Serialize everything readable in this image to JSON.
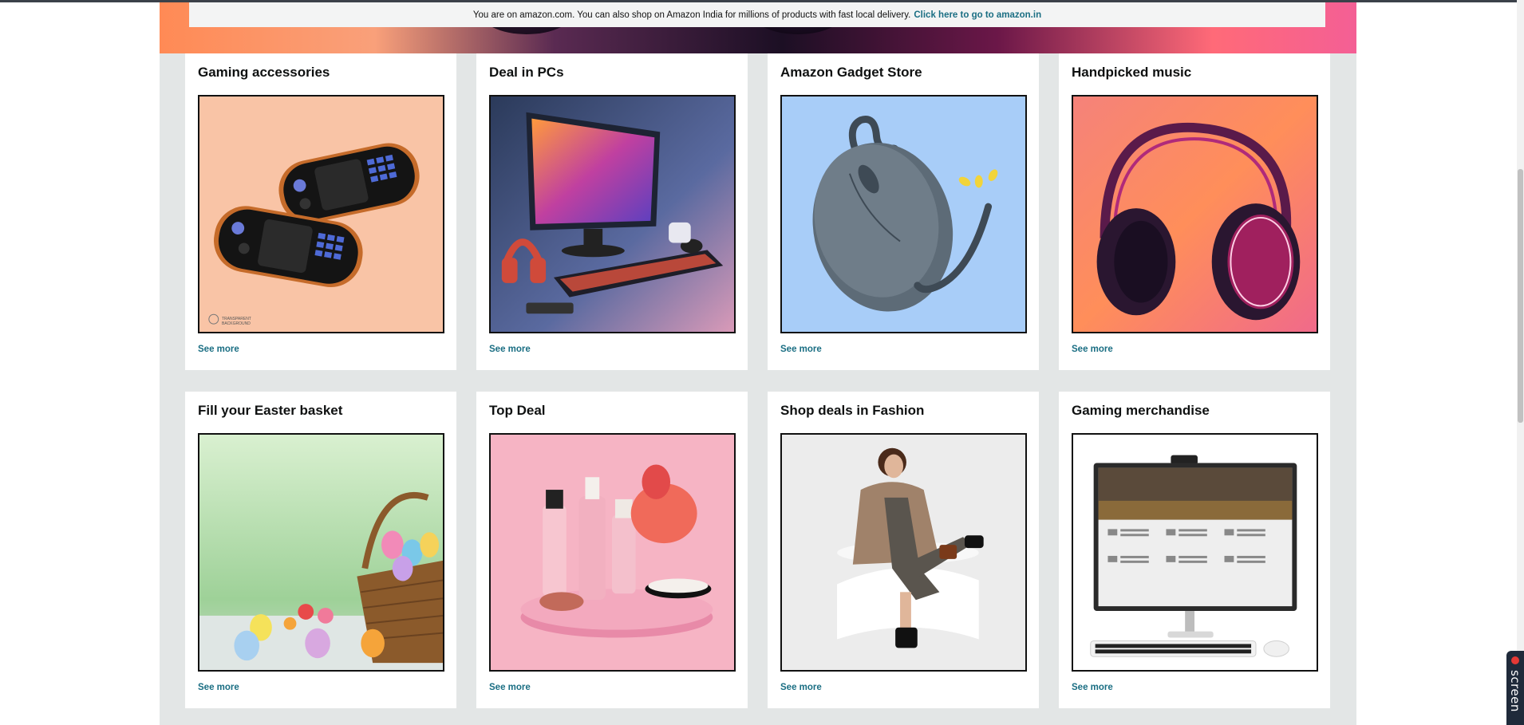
{
  "notice": {
    "text": "You are on amazon.com. You can also shop on Amazon India for millions of products with fast local delivery.",
    "link": "Click here to go to amazon.in"
  },
  "cards": [
    {
      "title": "Gaming accessories",
      "see_more": "See more",
      "image": "handheld-game-consoles",
      "image_caption": "TRANSPARENT BACKGROUND"
    },
    {
      "title": "Deal in PCs",
      "see_more": "See more",
      "image": "desktop-pc-setup"
    },
    {
      "title": "Amazon Gadget Store",
      "see_more": "See more",
      "image": "computer-mouse"
    },
    {
      "title": "Handpicked music",
      "see_more": "See more",
      "image": "headphones"
    },
    {
      "title": "Fill your Easter basket",
      "see_more": "See more",
      "image": "easter-basket"
    },
    {
      "title": "Top Deal",
      "see_more": "See more",
      "image": "cosmetics-display"
    },
    {
      "title": "Shop deals in Fashion",
      "see_more": "See more",
      "image": "fashion-model"
    },
    {
      "title": "Gaming merchandise",
      "see_more": "See more",
      "image": "monitor-keyboard"
    }
  ],
  "side_tab": {
    "label": "screen"
  },
  "colors": {
    "link": "#1a6e83",
    "page_bg": "#e3e6e6",
    "card_bg": "#ffffff"
  }
}
